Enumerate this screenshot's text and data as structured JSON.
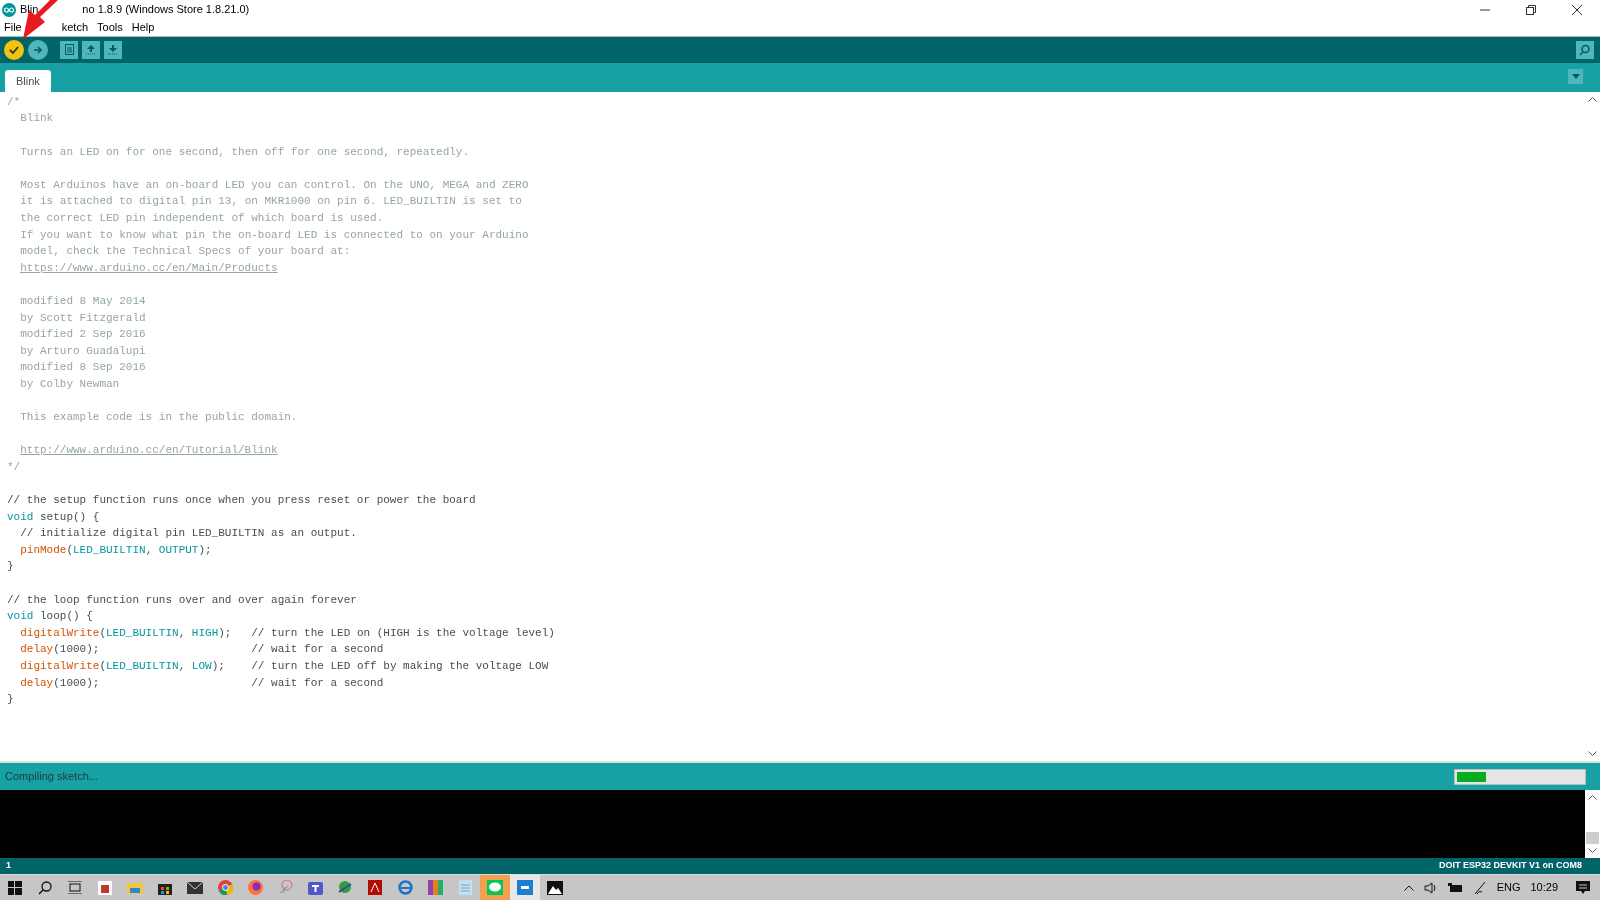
{
  "window": {
    "title_parts": [
      "Blin",
      "no 1.8.9 (Windows Store 1.8.21.0)"
    ]
  },
  "menu": [
    "File",
    "ketch",
    "Tools",
    "Help"
  ],
  "tabs": [
    {
      "label": "Blink",
      "selected": true
    }
  ],
  "code_lines": [
    {
      "kind": "code",
      "segments": [
        {
          "kind": "doc",
          "text": "/*"
        }
      ]
    },
    {
      "kind": "code",
      "segments": [
        {
          "kind": "doc",
          "text": "  Blink"
        }
      ]
    },
    {
      "kind": "blank"
    },
    {
      "kind": "code",
      "segments": [
        {
          "kind": "doc",
          "text": "  Turns an LED on for one second, then off for one second, repeatedly."
        }
      ]
    },
    {
      "kind": "blank"
    },
    {
      "kind": "code",
      "segments": [
        {
          "kind": "doc",
          "text": "  Most Arduinos have an on-board LED you can control. On the UNO, MEGA and ZERO"
        }
      ]
    },
    {
      "kind": "code",
      "segments": [
        {
          "kind": "doc",
          "text": "  it is attached to digital pin 13, on MKR1000 on pin 6. LED_BUILTIN is set to"
        }
      ]
    },
    {
      "kind": "code",
      "segments": [
        {
          "kind": "doc",
          "text": "  the correct LED pin independent of which board is used."
        }
      ]
    },
    {
      "kind": "code",
      "segments": [
        {
          "kind": "doc",
          "text": "  If you want to know what pin the on-board LED is connected to on your Arduino"
        }
      ]
    },
    {
      "kind": "code",
      "segments": [
        {
          "kind": "doc",
          "text": "  model, check the Technical Specs of your board at:"
        }
      ]
    },
    {
      "kind": "indented",
      "segments": [
        {
          "kind": "link",
          "text": "https://www.arduino.cc/en/Main/Products"
        }
      ]
    },
    {
      "kind": "blank"
    },
    {
      "kind": "code",
      "segments": [
        {
          "kind": "doc",
          "text": "  modified 8 May 2014"
        }
      ]
    },
    {
      "kind": "code",
      "segments": [
        {
          "kind": "doc",
          "text": "  by Scott Fitzgerald"
        }
      ]
    },
    {
      "kind": "code",
      "segments": [
        {
          "kind": "doc",
          "text": "  modified 2 Sep 2016"
        }
      ]
    },
    {
      "kind": "code",
      "segments": [
        {
          "kind": "doc",
          "text": "  by Arturo Guadalupi"
        }
      ]
    },
    {
      "kind": "code",
      "segments": [
        {
          "kind": "doc",
          "text": "  modified 8 Sep 2016"
        }
      ]
    },
    {
      "kind": "code",
      "segments": [
        {
          "kind": "doc",
          "text": "  by Colby Newman"
        }
      ]
    },
    {
      "kind": "blank"
    },
    {
      "kind": "code",
      "segments": [
        {
          "kind": "doc",
          "text": "  This example code is in the public domain."
        }
      ]
    },
    {
      "kind": "blank"
    },
    {
      "kind": "indented",
      "segments": [
        {
          "kind": "link",
          "text": "http://www.arduino.cc/en/Tutorial/Blink"
        }
      ]
    },
    {
      "kind": "code",
      "segments": [
        {
          "kind": "doc",
          "text": "*/"
        }
      ]
    },
    {
      "kind": "blank"
    },
    {
      "kind": "code",
      "segments": [
        {
          "kind": "comment",
          "text": "// the setup function runs once when you press reset or power the board"
        }
      ]
    },
    {
      "kind": "code",
      "segments": [
        {
          "kind": "keyword",
          "text": "void"
        },
        {
          "kind": "plain",
          "text": " setup() {"
        }
      ]
    },
    {
      "kind": "indented",
      "segments": [
        {
          "kind": "comment",
          "text": "// initialize digital pin LED_BUILTIN as an output."
        }
      ]
    },
    {
      "kind": "indented",
      "segments": [
        {
          "kind": "function",
          "text": "pinMode"
        },
        {
          "kind": "plain",
          "text": "("
        },
        {
          "kind": "constant",
          "text": "LED_BUILTIN"
        },
        {
          "kind": "plain",
          "text": ", "
        },
        {
          "kind": "constant",
          "text": "OUTPUT"
        },
        {
          "kind": "plain",
          "text": ");"
        }
      ]
    },
    {
      "kind": "code",
      "segments": [
        {
          "kind": "plain",
          "text": "}"
        }
      ]
    },
    {
      "kind": "blank"
    },
    {
      "kind": "code",
      "segments": [
        {
          "kind": "comment",
          "text": "// the loop function runs over and over again forever"
        }
      ]
    },
    {
      "kind": "code",
      "segments": [
        {
          "kind": "keyword",
          "text": "void"
        },
        {
          "kind": "plain",
          "text": " loop() {"
        }
      ]
    },
    {
      "kind": "indented",
      "segments": [
        {
          "kind": "function",
          "text": "digitalWrite"
        },
        {
          "kind": "plain",
          "text": "("
        },
        {
          "kind": "constant",
          "text": "LED_BUILTIN"
        },
        {
          "kind": "plain",
          "text": ", "
        },
        {
          "kind": "constant",
          "text": "HIGH"
        },
        {
          "kind": "plain",
          "text": ");   "
        },
        {
          "kind": "comment",
          "text": "// turn the LED on (HIGH is the voltage level)"
        }
      ]
    },
    {
      "kind": "indented",
      "segments": [
        {
          "kind": "function",
          "text": "delay"
        },
        {
          "kind": "plain",
          "text": "(1000);                       "
        },
        {
          "kind": "comment",
          "text": "// wait for a second"
        }
      ]
    },
    {
      "kind": "indented",
      "segments": [
        {
          "kind": "function",
          "text": "digitalWrite"
        },
        {
          "kind": "plain",
          "text": "("
        },
        {
          "kind": "constant",
          "text": "LED_BUILTIN"
        },
        {
          "kind": "plain",
          "text": ", "
        },
        {
          "kind": "constant",
          "text": "LOW"
        },
        {
          "kind": "plain",
          "text": ");    "
        },
        {
          "kind": "comment",
          "text": "// turn the LED off by making the voltage LOW"
        }
      ]
    },
    {
      "kind": "indented",
      "segments": [
        {
          "kind": "function",
          "text": "delay"
        },
        {
          "kind": "plain",
          "text": "(1000);                       "
        },
        {
          "kind": "comment",
          "text": "// wait for a second"
        }
      ]
    },
    {
      "kind": "code",
      "segments": [
        {
          "kind": "plain",
          "text": "}"
        }
      ]
    }
  ],
  "status": {
    "message": "Compiling sketch...",
    "progress": {
      "level": 0.23
    }
  },
  "bottom_bar": {
    "line": "1",
    "board": "DOIT ESP32 DEVKIT V1 on COM8"
  },
  "taskbar": {
    "language": "ENG",
    "time": "10:29"
  }
}
